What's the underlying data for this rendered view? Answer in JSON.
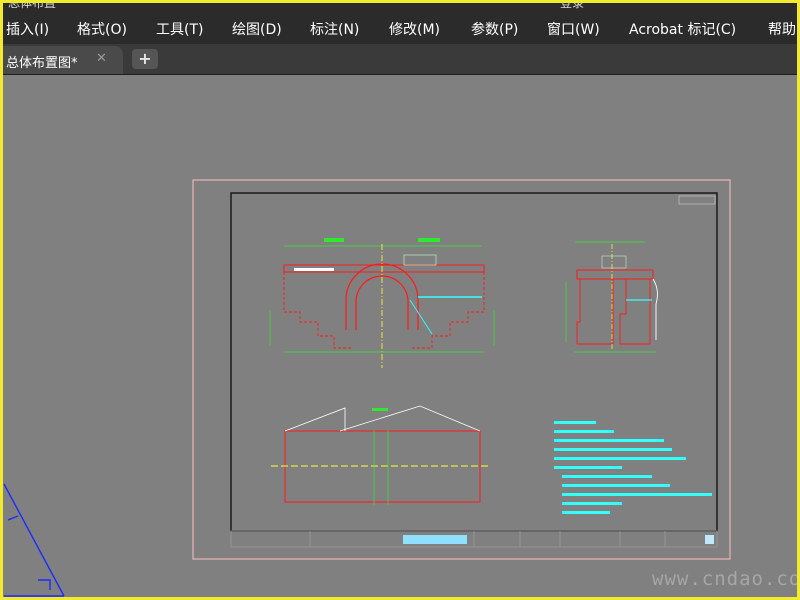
{
  "topstrip": {
    "title_fragment": "总体布置",
    "window_fragment": "登录"
  },
  "menu": {
    "items": [
      "插入(I)",
      "格式(O)",
      "工具(T)",
      "绘图(D)",
      "标注(N)",
      "修改(M)",
      "参数(P)",
      "窗口(W)",
      "Acrobat 标记(C)",
      "帮助"
    ]
  },
  "tabs": {
    "active_label": "总体布置图*",
    "close_symbol": "✕",
    "add_symbol": "+"
  },
  "watermark": "www.cndao.com",
  "colors": {
    "menubar_bg": "#2b2b2b",
    "canvas_bg": "#808080",
    "paper_border": "#e8b5b5",
    "drawing_frame": "#1a1a1a",
    "red_lines": "#ff1a1a",
    "green_dims": "#2fe82f",
    "cyan_notes": "#33ffff",
    "yellow_axis": "#ffff33",
    "white_lines": "#ffffff",
    "blue_ucs": "#1a2cff",
    "outer_border": "#f2ea2e"
  }
}
